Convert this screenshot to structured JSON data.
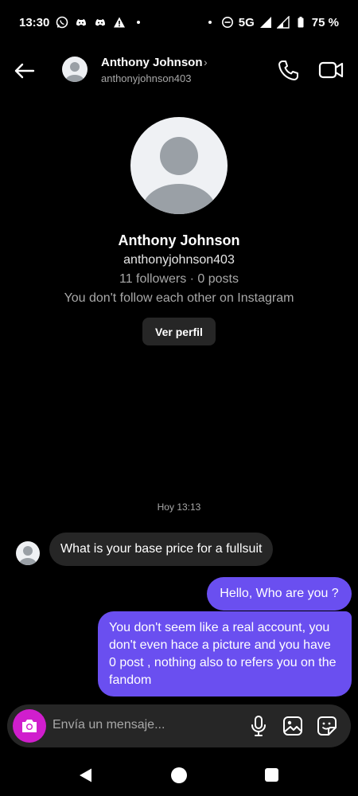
{
  "status_bar": {
    "time": "13:30",
    "network": "5G",
    "battery": "75 %",
    "left_icons": [
      "whatsapp-icon",
      "discord-icon",
      "discord-icon",
      "warning-icon",
      "dot-icon"
    ],
    "right_icons": [
      "dot-icon",
      "dnd-icon",
      "signal-icon",
      "signal-icon",
      "battery-icon"
    ]
  },
  "header": {
    "name": "Anthony Johnson",
    "username": "anthonyjohnson403",
    "chevron": "›"
  },
  "profile": {
    "name": "Anthony Johnson",
    "username": "anthonyjohnson403",
    "stats": "11 followers · 0 posts",
    "mutual": "You don't follow each other on Instagram",
    "view_button": "Ver perfil"
  },
  "conversation": {
    "timestamp": "Hoy 13:13",
    "messages": [
      {
        "from": "them",
        "text": "What is your base price for a fullsuit"
      },
      {
        "from": "me",
        "text": "Hello, Who are you ?"
      },
      {
        "from": "me",
        "text": "You don't seem like a real account, you don't even hace a picture and you have 0 post , nothing also to refers you on the fandom"
      }
    ]
  },
  "composer": {
    "placeholder": "Envía un mensaje..."
  },
  "colors": {
    "background": "#000000",
    "bubble_incoming": "#262626",
    "bubble_outgoing": "#6a4ff0",
    "camera_button": "#d01ecd",
    "secondary_text": "#a8a8a8"
  }
}
